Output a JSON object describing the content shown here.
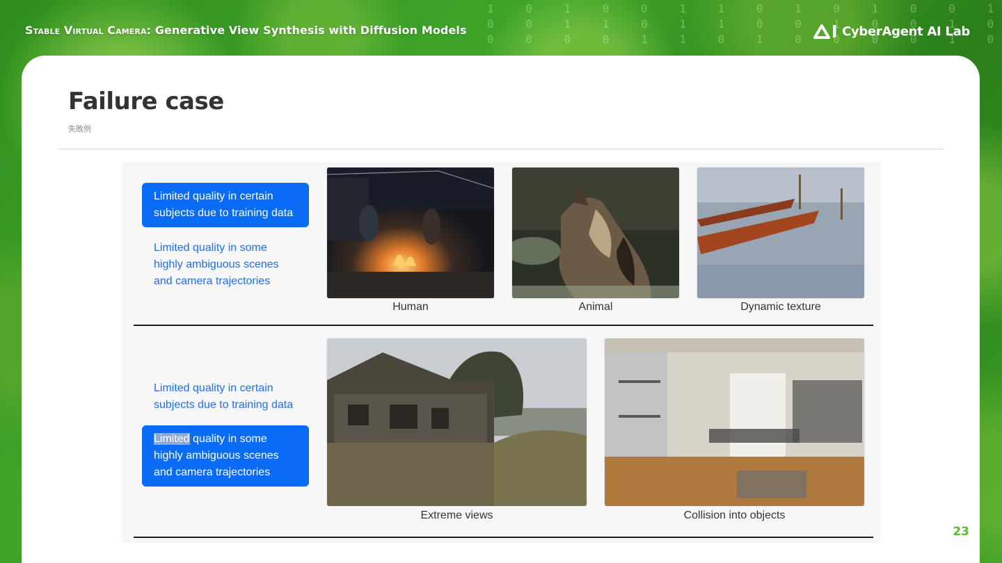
{
  "header": {
    "title_smallcaps": "Stable Virtual Camera",
    "title_rest": ": Generative View Synthesis with Diffusion Models",
    "logo_text": "CyberAgent AI Lab",
    "digits_row1": "1 0 1 0 0 1 1 0 1 0 1 0 0 1",
    "digits_row2": "0 0 1 1 0 1 1 0 0 1 0 0 1 0",
    "digits_row3": "0 0 0 0 1 1 0 1 0 0 0 0 1 0"
  },
  "slide": {
    "title": "Failure case",
    "subtitle": "失敗例",
    "page_number": "23"
  },
  "figure": {
    "top": {
      "option_1": "Limited quality in certain subjects due to training data",
      "option_2": "Limited quality in some highly ambiguous scenes and camera trajectories",
      "captions": [
        "Human",
        "Animal",
        "Dynamic texture"
      ]
    },
    "bottom": {
      "option_1": "Limited quality in certain subjects due to training data",
      "option_2_highlight": "Limited",
      "option_2_rest": " quality in some highly ambiguous scenes and camera trajectories",
      "captions": [
        "Extreme views",
        "Collision into objects"
      ]
    }
  },
  "colors": {
    "accent_blue": "#0a6cf5",
    "link_blue": "#1f6fe8",
    "page_number_green": "#5cb82d"
  }
}
